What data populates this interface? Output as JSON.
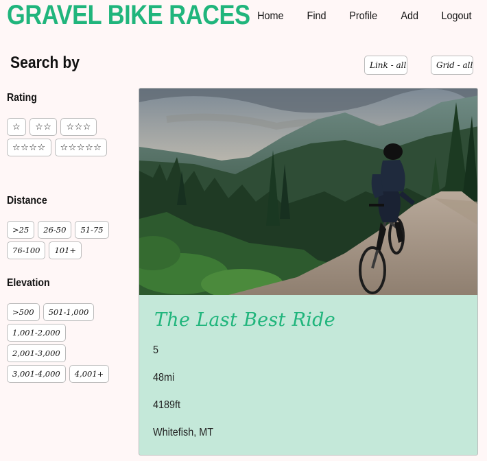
{
  "header": {
    "title": "GRAVEL BIKE RACES",
    "nav": [
      "Home",
      "Find",
      "Profile",
      "Add",
      "Logout"
    ]
  },
  "search": {
    "heading": "Search by",
    "view_link_label": "Link - all",
    "view_grid_label": "Grid - all"
  },
  "filters": {
    "rating": {
      "label": "Rating",
      "options": [
        "☆",
        "☆☆",
        "☆☆☆",
        "☆☆☆☆",
        "☆☆☆☆☆"
      ]
    },
    "distance": {
      "label": "Distance",
      "options": [
        ">25",
        "26-50",
        "51-75",
        "76-100",
        "101+"
      ]
    },
    "elevation": {
      "label": "Elevation",
      "options": [
        ">500",
        "501-1,000",
        "1,001-2,000",
        "2,001-3,000",
        "3,001-4,000",
        "4,001+"
      ]
    }
  },
  "race": {
    "title": "The Last Best Ride",
    "rating": "5",
    "distance": "48mi",
    "elevation": "4189ft",
    "location": "Whitefish, MT"
  },
  "colors": {
    "brand": "#20b57c",
    "background": "#fff7f7",
    "card": "#c4e8d9"
  }
}
